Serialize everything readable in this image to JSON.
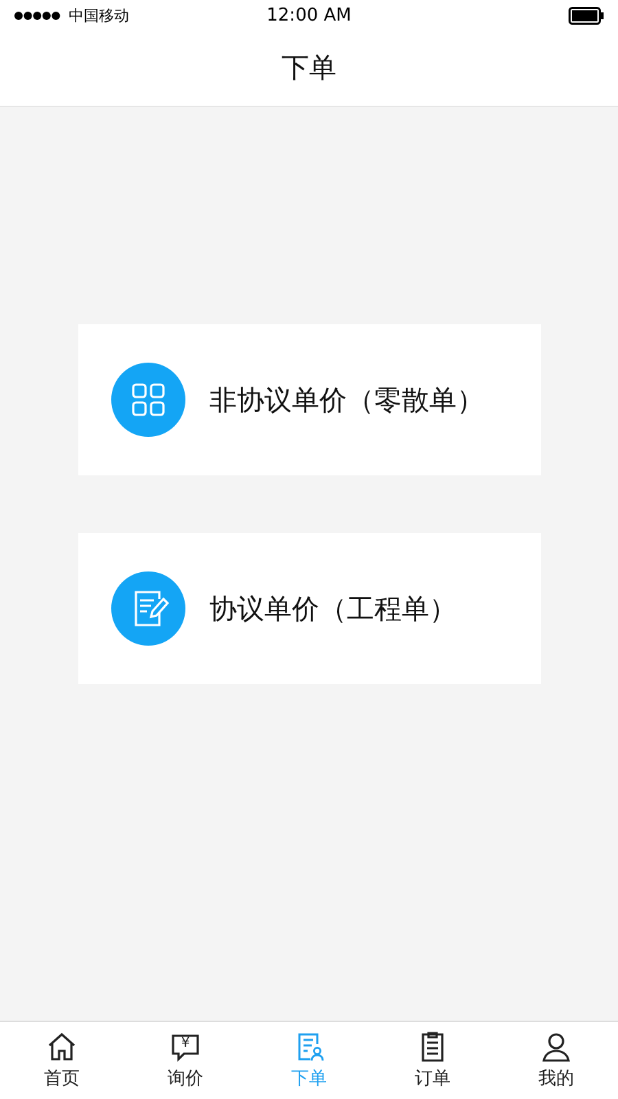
{
  "status_bar": {
    "carrier": "中国移动",
    "time": "12:00 AM"
  },
  "nav_bar": {
    "title": "下单"
  },
  "options": [
    {
      "kind": "grid",
      "label": "非协议单价（零散单）"
    },
    {
      "kind": "note",
      "label": "协议单价（工程单）"
    }
  ],
  "tabs": [
    {
      "kind": "home",
      "label": "首页",
      "selected": false
    },
    {
      "kind": "quote",
      "label": "询价",
      "selected": false,
      "icon_text": "¥"
    },
    {
      "kind": "order",
      "label": "下单",
      "selected": true
    },
    {
      "kind": "list",
      "label": "订单",
      "selected": false
    },
    {
      "kind": "user",
      "label": "我的",
      "selected": false
    }
  ]
}
